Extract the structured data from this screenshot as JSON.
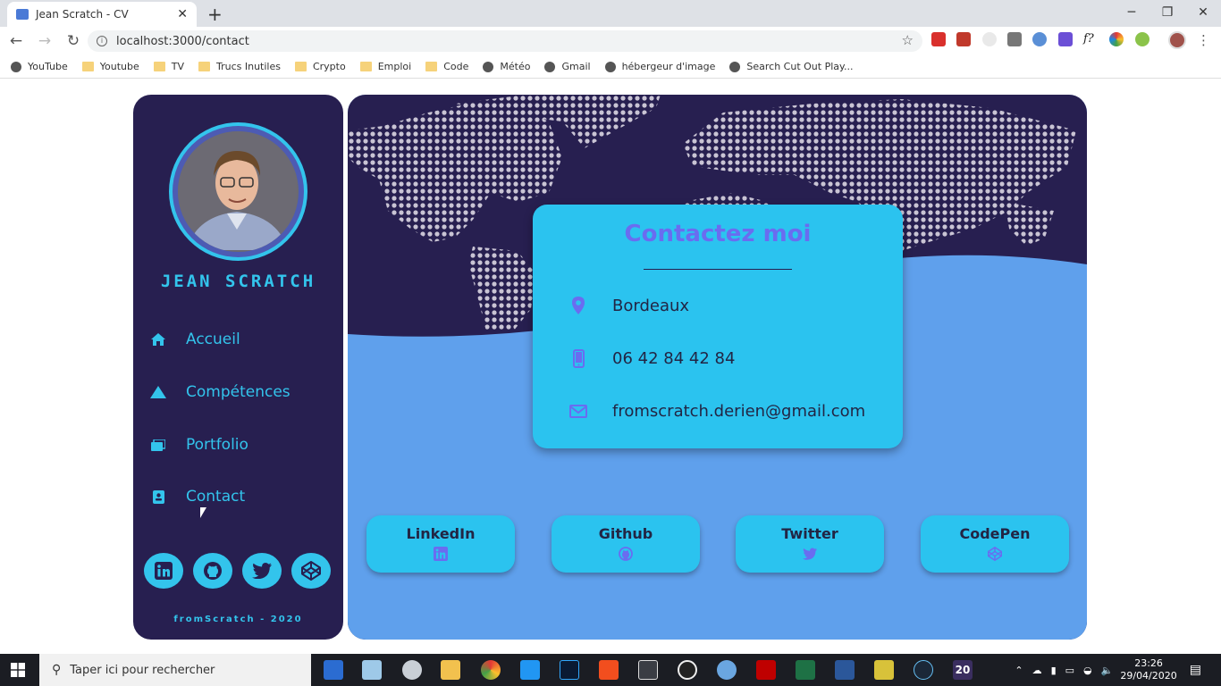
{
  "browser": {
    "tab_title": "Jean Scratch - CV",
    "url": "localhost:3000/contact",
    "bookmarks": [
      {
        "label": "YouTube",
        "icon": "globe-icon"
      },
      {
        "label": "Youtube",
        "icon": "folder-icon"
      },
      {
        "label": "TV",
        "icon": "folder-icon"
      },
      {
        "label": "Trucs Inutiles",
        "icon": "folder-icon"
      },
      {
        "label": "Crypto",
        "icon": "folder-icon"
      },
      {
        "label": "Emploi",
        "icon": "folder-icon"
      },
      {
        "label": "Code",
        "icon": "folder-icon"
      },
      {
        "label": "Météo",
        "icon": "globe-icon"
      },
      {
        "label": "Gmail",
        "icon": "globe-icon"
      },
      {
        "label": "hébergeur d'image",
        "icon": "globe-icon"
      },
      {
        "label": "Search Cut Out Play...",
        "icon": "globe-icon"
      }
    ]
  },
  "sidebar": {
    "name": "JEAN SCRATCH",
    "menu": [
      {
        "label": "Accueil",
        "icon": "home-icon"
      },
      {
        "label": "Compétences",
        "icon": "triangle-icon"
      },
      {
        "label": "Portfolio",
        "icon": "images-icon"
      },
      {
        "label": "Contact",
        "icon": "contact-card-icon"
      }
    ],
    "socials": [
      "linkedin-icon",
      "github-icon",
      "twitter-icon",
      "codepen-icon"
    ],
    "footer": "fromScratch - 2020"
  },
  "contact": {
    "title": "Contactez moi",
    "city": "Bordeaux",
    "phone": "06 42 84 42 84",
    "email": "fromscratch.derien@gmail.com"
  },
  "social_buttons": [
    {
      "label": "LinkedIn",
      "icon": "linkedin-icon"
    },
    {
      "label": "Github",
      "icon": "github-icon"
    },
    {
      "label": "Twitter",
      "icon": "twitter-icon"
    },
    {
      "label": "CodePen",
      "icon": "codepen-icon"
    }
  ],
  "taskbar": {
    "search_placeholder": "Taper ici pour rechercher",
    "time": "23:26",
    "date": "29/04/2020",
    "badge": "20"
  },
  "colors": {
    "sidebar_bg": "#271f50",
    "accent": "#33c4ec",
    "card_bg": "#2bc3ef",
    "main_bg": "#5fa0ec",
    "title": "#6a6cf0"
  }
}
